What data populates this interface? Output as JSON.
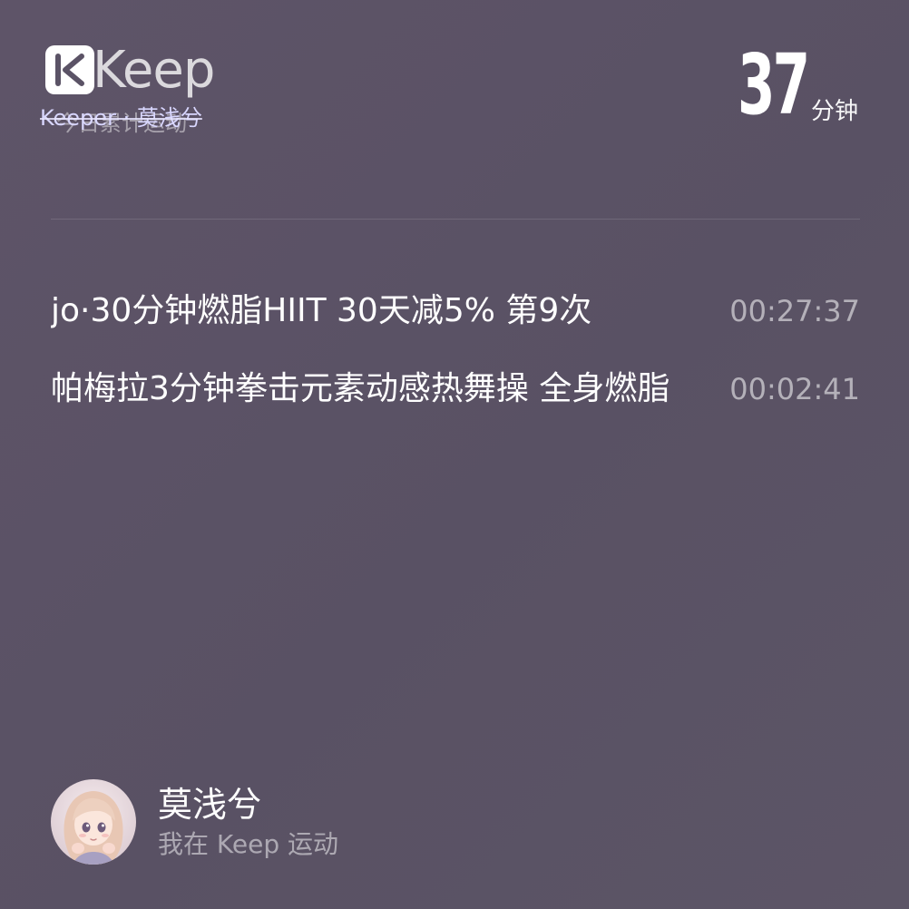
{
  "header": {
    "logo_text": "Keep",
    "subtitle": "Keeper · 莫浅兮",
    "subtitle_ghost": "今日累计运动",
    "total_value": "37",
    "total_unit": "分钟"
  },
  "workouts": [
    {
      "title": "jo·30分钟燃脂HIIT 30天减5% 第9次",
      "duration": "00:27:37"
    },
    {
      "title": "帕梅拉3分钟拳击元素动感热舞操 全身燃脂",
      "duration": "00:02:41"
    }
  ],
  "user": {
    "name": "莫浅兮",
    "status": "我在 Keep 运动"
  },
  "icons": {
    "logo": "keep-logo-icon",
    "avatar": "user-avatar"
  },
  "colors": {
    "background": "#5b5366",
    "text_primary": "#ffffff",
    "subtitle": "#d9d7ff"
  }
}
